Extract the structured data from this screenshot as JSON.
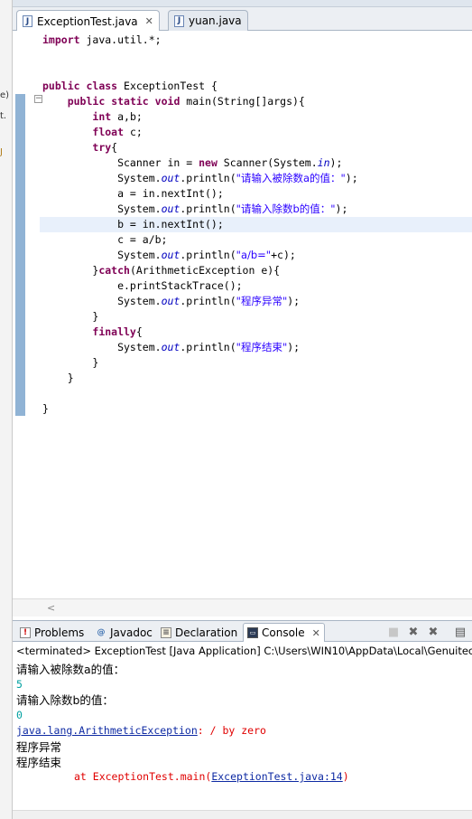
{
  "left_strip": {
    "fragments": [
      "e)",
      "t.",
      "J"
    ]
  },
  "editor_tabs": [
    {
      "label": "ExceptionTest.java",
      "active": true,
      "closable": true
    },
    {
      "label": "yuan.java",
      "active": false,
      "closable": false
    }
  ],
  "code": {
    "lines": [
      "import java.util.*;",
      "",
      "",
      "public class ExceptionTest {",
      "    public static void main(String[]args){",
      "        int a,b;",
      "        float c;",
      "        try{",
      "            Scanner in = new Scanner(System.in);",
      "            System.out.println(\"请输入被除数a的值：\");",
      "            a = in.nextInt();",
      "            System.out.println(\"请输入除数b的值：\");",
      "            b = in.nextInt();",
      "            c = a/b;",
      "            System.out.println(\"a/b=\"+c);",
      "        }catch(ArithmeticException e){",
      "            e.printStackTrace();",
      "            System.out.println(\"程序异常\");",
      "        }",
      "        finally{",
      "            System.out.println(\"程序结束\");",
      "        }",
      "    }",
      "",
      "}"
    ],
    "current_line": 12
  },
  "panel_tabs": [
    {
      "label": "Problems",
      "icon": "problems-icon",
      "active": false
    },
    {
      "label": "Javadoc",
      "icon": "javadoc-icon",
      "active": false
    },
    {
      "label": "Declaration",
      "icon": "declaration-icon",
      "active": false
    },
    {
      "label": "Console",
      "icon": "console-icon",
      "active": true
    }
  ],
  "console": {
    "title": "<terminated> ExceptionTest [Java Application] C:\\Users\\WIN10\\AppData\\Local\\Genuitec",
    "prompt_a": "请输入被除数a的值：",
    "input_a": "5",
    "prompt_b": "请输入除数b的值：",
    "input_b": "0",
    "exception_class": "java.lang.ArithmeticException",
    "exception_msg": ": / by zero",
    "out_abnormal": "程序异常",
    "out_end": "程序结束",
    "trace_prefix": "at ExceptionTest.main(",
    "trace_link": "ExceptionTest.java:14",
    "trace_suffix": ")"
  },
  "colors": {
    "keyword": "#7f0055",
    "string": "#2a00ff",
    "field": "#0000c0",
    "stderr": "#e00000",
    "stdin": "#00a0a0",
    "change_bar": "#6b9ac7",
    "current_line": "#e8f0fb"
  }
}
